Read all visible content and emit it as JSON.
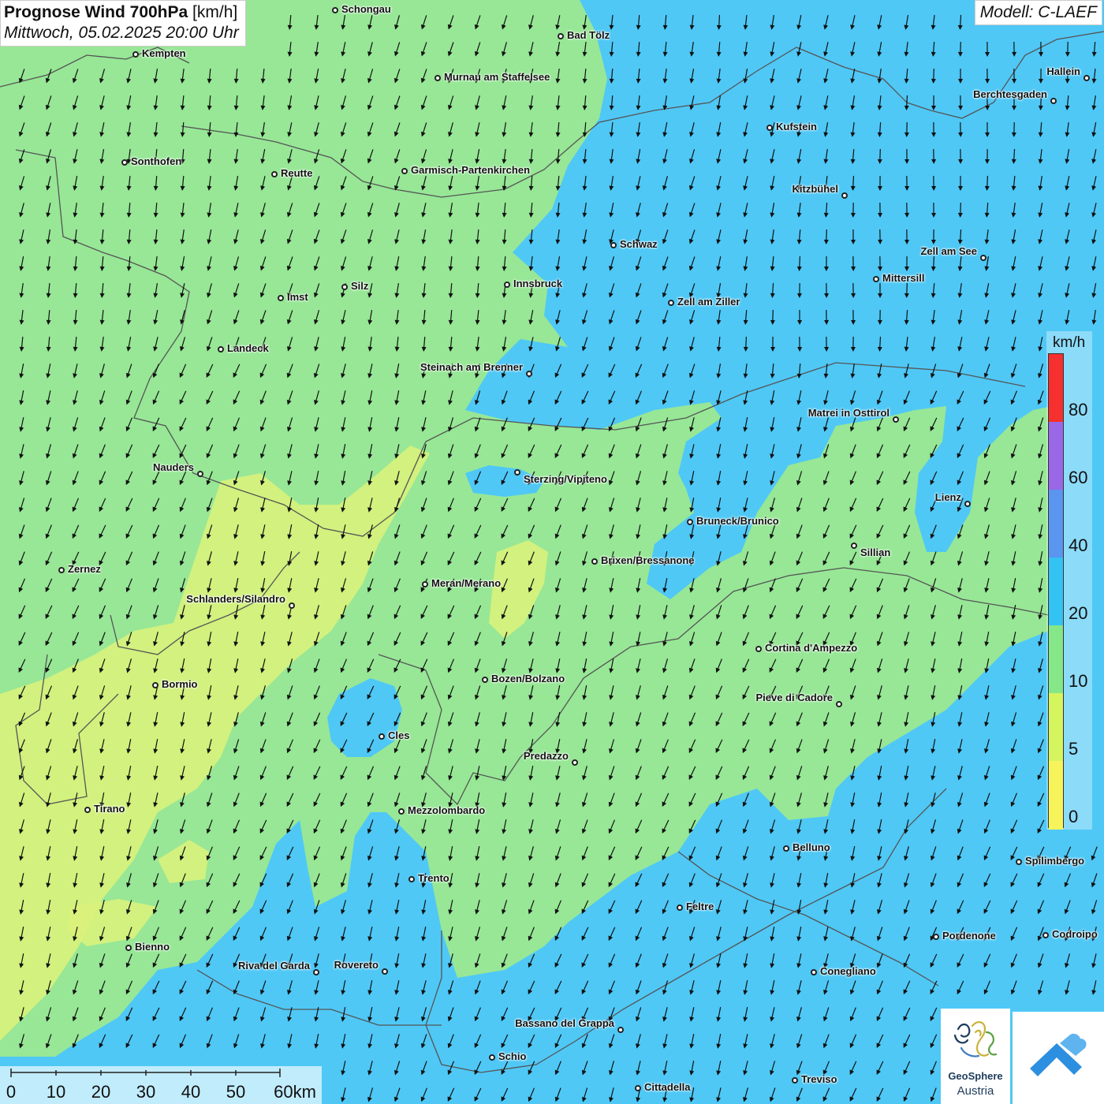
{
  "header": {
    "title_bold": "Prognose Wind 700hPa",
    "title_unit": "[km/h]",
    "datetime": "Mittwoch, 05.02.2025 20:00 Uhr",
    "model": "Modell: C-LAEF"
  },
  "legend": {
    "unit": "km/h",
    "labels": [
      "80",
      "60",
      "40",
      "20",
      "10",
      "5",
      "0"
    ],
    "colors": [
      "#f5302e",
      "#9a68e6",
      "#5a95ef",
      "#33c3f3",
      "#85e788",
      "#d5f55f",
      "#f7f35a"
    ]
  },
  "colors": {
    "zone_fast": "#4fc8f6",
    "zone_medium": "#97e796",
    "zone_slow": "#dcf27a",
    "arrow": "#111111",
    "border": "#555555"
  },
  "cities": [
    {
      "name": "Schongau"
    },
    {
      "name": "Bad Tölz"
    },
    {
      "name": "Kempten"
    },
    {
      "name": "Murnau am Staffelsee"
    },
    {
      "name": "Hallein"
    },
    {
      "name": "Berchtesgaden"
    },
    {
      "name": "Kufstein"
    },
    {
      "name": "Sonthofen"
    },
    {
      "name": "Reutte"
    },
    {
      "name": "Garmisch-Partenkirchen"
    },
    {
      "name": "Kitzbühel"
    },
    {
      "name": "Schwaz"
    },
    {
      "name": "Zell am See"
    },
    {
      "name": "Mittersill"
    },
    {
      "name": "Innsbruck"
    },
    {
      "name": "Imst"
    },
    {
      "name": "Silz"
    },
    {
      "name": "Zell am Ziller"
    },
    {
      "name": "Landeck"
    },
    {
      "name": "Steinach am Brenner"
    },
    {
      "name": "Matrei in Osttirol"
    },
    {
      "name": "Nauders"
    },
    {
      "name": "Sterzing/Vipiteno"
    },
    {
      "name": "Lienz"
    },
    {
      "name": "Bruneck/Brunico"
    },
    {
      "name": "Sillian"
    },
    {
      "name": "Zernez"
    },
    {
      "name": "Brixen/Bressanone"
    },
    {
      "name": "Meran/Merano"
    },
    {
      "name": "Schlanders/Silandro"
    },
    {
      "name": "Cortina d'Ampezzo"
    },
    {
      "name": "Bozen/Bolzano"
    },
    {
      "name": "Bormio"
    },
    {
      "name": "Pieve di Cadore"
    },
    {
      "name": "Cles"
    },
    {
      "name": "Predazzo"
    },
    {
      "name": "Tirano"
    },
    {
      "name": "Mezzolombardo"
    },
    {
      "name": "Belluno"
    },
    {
      "name": "Spilimbergo"
    },
    {
      "name": "Trento"
    },
    {
      "name": "Feltre"
    },
    {
      "name": "Pordenone"
    },
    {
      "name": "Codroipo"
    },
    {
      "name": "Bienno"
    },
    {
      "name": "Riva del Garda"
    },
    {
      "name": "Rovereto"
    },
    {
      "name": "Conegliano"
    },
    {
      "name": "Bassano del Grappa"
    },
    {
      "name": "Schio"
    },
    {
      "name": "Treviso"
    },
    {
      "name": "Cittadella"
    }
  ],
  "scalebar": {
    "labels": [
      "0",
      "10",
      "20",
      "30",
      "40",
      "50",
      "60km"
    ]
  },
  "logos": {
    "geosphere_name": "GeoSphere",
    "geosphere_sub": "Austria"
  },
  "wind_field": {
    "direction": "from north-northeast",
    "arrow_color": "#111111"
  }
}
